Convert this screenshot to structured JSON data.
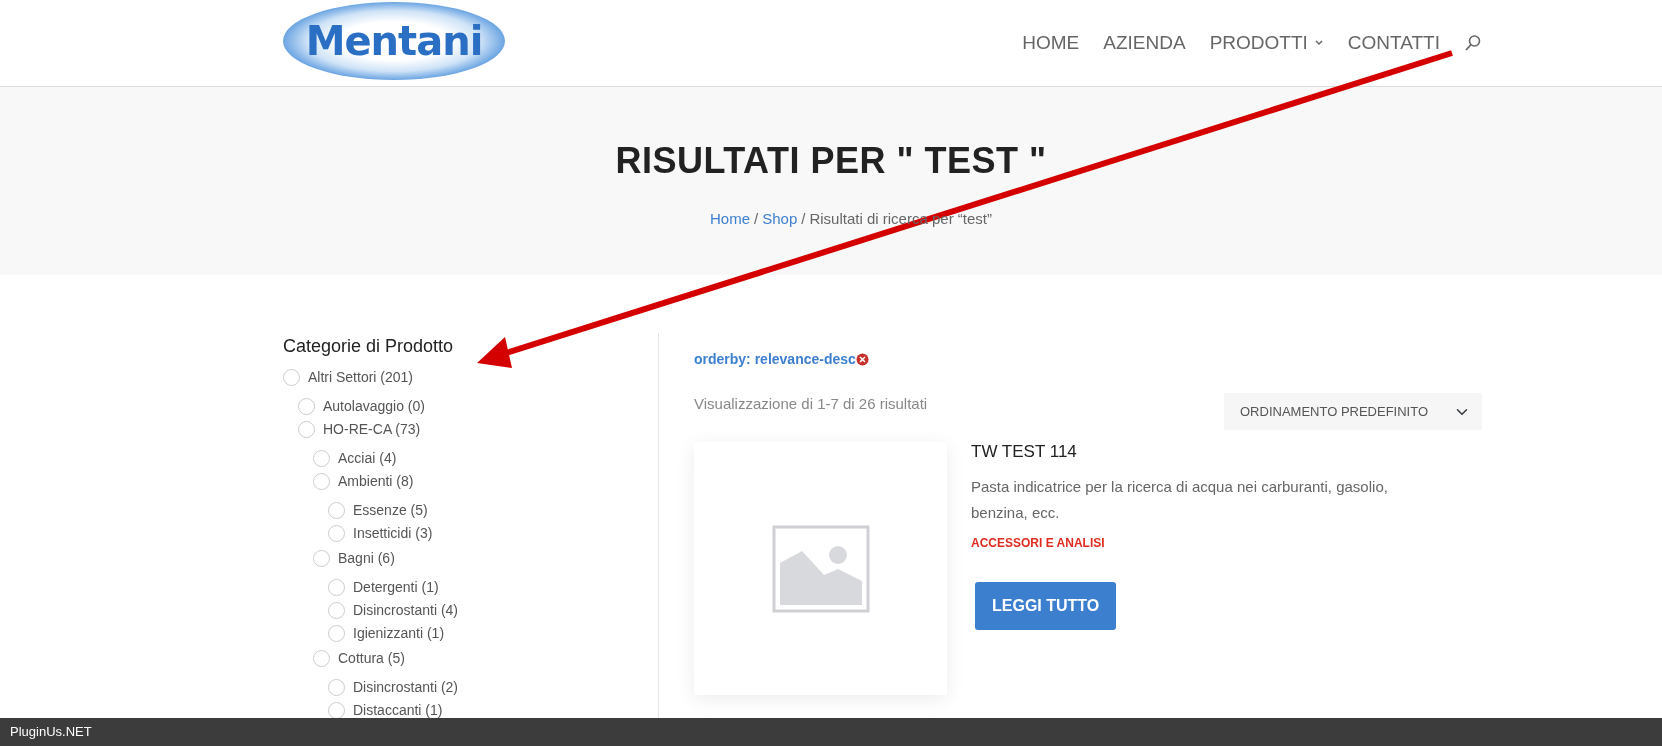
{
  "header": {
    "logo_text": "Mentani",
    "nav": [
      {
        "label": "HOME",
        "has_dropdown": false
      },
      {
        "label": "AZIENDA",
        "has_dropdown": false
      },
      {
        "label": "PRODOTTI",
        "has_dropdown": true
      },
      {
        "label": "CONTATTI",
        "has_dropdown": false
      }
    ]
  },
  "hero": {
    "title": "RISULTATI PER \" TEST \"",
    "breadcrumb": [
      {
        "label": "Home",
        "kind": "link"
      },
      {
        "label": "/",
        "kind": "separator"
      },
      {
        "label": "Shop",
        "kind": "link"
      },
      {
        "label": "/",
        "kind": "separator"
      },
      {
        "label": "Risultati di ricerca per “test”",
        "kind": "current"
      }
    ]
  },
  "sidebar": {
    "title": "Categorie di Prodotto",
    "categories": [
      {
        "label": "Altri Settori",
        "count": "(201)",
        "checked": false,
        "children": [
          {
            "label": "Autolavaggio",
            "count": "(0)",
            "checked": false
          },
          {
            "label": "HO-RE-CA",
            "count": "(73)",
            "checked": false,
            "children": [
              {
                "label": "Acciai",
                "count": "(4)",
                "checked": false
              },
              {
                "label": "Ambienti",
                "count": "(8)",
                "checked": false,
                "children": [
                  {
                    "label": "Essenze",
                    "count": "(5)",
                    "checked": false
                  },
                  {
                    "label": "Insetticidi",
                    "count": "(3)",
                    "checked": false
                  }
                ]
              },
              {
                "label": "Bagni",
                "count": "(6)",
                "checked": false,
                "children": [
                  {
                    "label": "Detergenti",
                    "count": "(1)",
                    "checked": false
                  },
                  {
                    "label": "Disincrostanti",
                    "count": "(4)",
                    "checked": false
                  },
                  {
                    "label": "Igienizzanti",
                    "count": "(1)",
                    "checked": false
                  }
                ]
              },
              {
                "label": "Cottura",
                "count": "(5)",
                "checked": false,
                "children": [
                  {
                    "label": "Disincrostanti",
                    "count": "(2)",
                    "checked": false
                  },
                  {
                    "label": "Distaccanti",
                    "count": "(1)",
                    "checked": false
                  }
                ]
              }
            ]
          }
        ]
      }
    ]
  },
  "filter_tag": {
    "label": "orderby: relevance-desc"
  },
  "results_count": "Visualizzazione di 1-7 di 26 risultati",
  "sort_select": {
    "value": "ORDINAMENTO PREDEFINITO"
  },
  "products": [
    {
      "title": "TW TEST 114",
      "description": "Pasta indicatrice per la ricerca di acqua nei carburanti, gasolio, benzina, ecc.",
      "category": "ACCESSORI E ANALISI",
      "button": "LEGGI TUTTO"
    }
  ],
  "bottom_bar": {
    "text": "PluginUs.NET"
  }
}
